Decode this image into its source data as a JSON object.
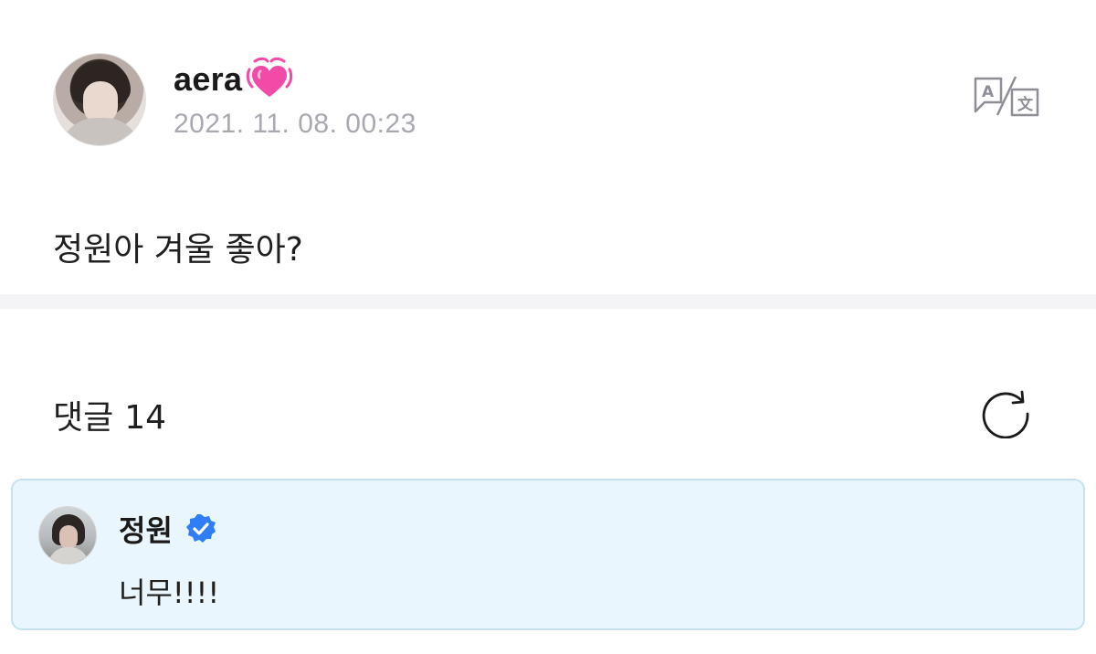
{
  "post": {
    "author": "aera",
    "author_badge_icon": "growing-heart-icon",
    "timestamp": "2021. 11. 08. 00:23",
    "body": "정원아 겨울 좋아?",
    "translate_icon": "translate-icon"
  },
  "comments": {
    "label": "댓글",
    "count": "14",
    "refresh_icon": "refresh-icon",
    "items": [
      {
        "author": "정원",
        "verified_icon": "verified-badge-icon",
        "text": "너무!!!!"
      }
    ]
  },
  "colors": {
    "accent_verified": "#2f7ef5",
    "heart": "#f24aa7",
    "timestamp_gray": "#a9a9b1",
    "comment_bg": "#e9f6fd",
    "comment_border": "#c6e2ef",
    "divider": "#f4f4f7"
  }
}
